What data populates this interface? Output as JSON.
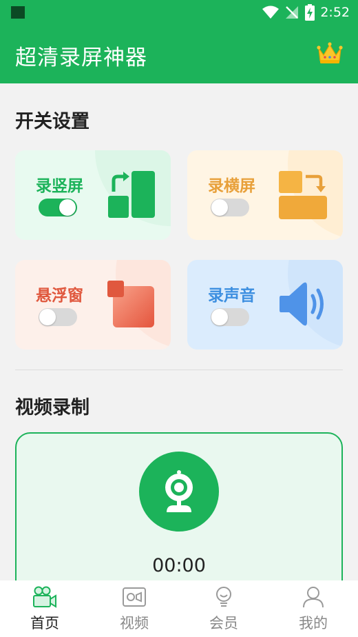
{
  "status_bar": {
    "time": "2:52"
  },
  "app": {
    "title": "超清录屏神器",
    "brand_color": "#1cb35a",
    "vip_icon": "crown-icon"
  },
  "switch_section": {
    "title": "开关设置",
    "cards": [
      {
        "label": "录竖屏",
        "enabled": true,
        "label_color": "#1cb35a",
        "icon": "portrait-rotate-icon"
      },
      {
        "label": "录横屏",
        "enabled": false,
        "label_color": "#e8a03a",
        "icon": "landscape-rotate-icon"
      },
      {
        "label": "悬浮窗",
        "enabled": false,
        "label_color": "#e0583e",
        "icon": "floating-window-icon"
      },
      {
        "label": "录声音",
        "enabled": false,
        "label_color": "#3d8fe0",
        "icon": "speaker-icon"
      }
    ]
  },
  "video_section": {
    "title": "视频录制",
    "record_icon": "webcam-icon",
    "elapsed": "00:00"
  },
  "bottom_nav": {
    "items": [
      {
        "label": "首页",
        "icon": "video-camera-icon",
        "active": true
      },
      {
        "label": "视频",
        "icon": "video-file-icon",
        "active": false
      },
      {
        "label": "会员",
        "icon": "lightbulb-icon",
        "active": false
      },
      {
        "label": "我的",
        "icon": "user-icon",
        "active": false
      }
    ]
  }
}
